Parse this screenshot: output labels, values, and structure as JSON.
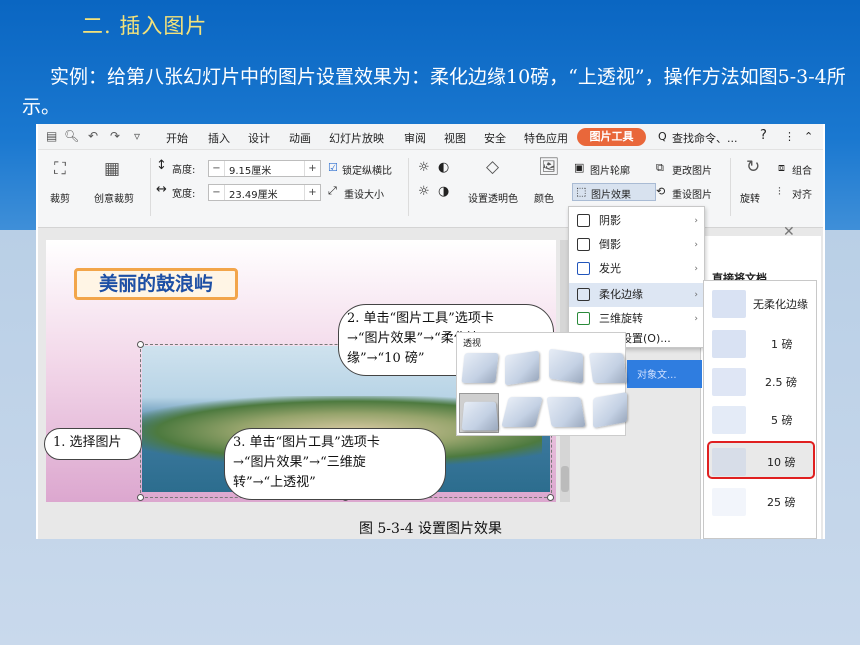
{
  "slide": {
    "heading": "二. 插入图片",
    "body": "实例：给第八张幻灯片中的图片设置效果为：柔化边缘10磅，“上透视”，操作方法如图5-3-4所示。",
    "caption": "图 5-3-4  设置图片效果"
  },
  "menubar": {
    "items": [
      "开始",
      "插入",
      "设计",
      "动画",
      "幻灯片放映",
      "审阅",
      "视图",
      "安全",
      "特色应用"
    ],
    "active_tab": "图片工具",
    "search": "查找命令、...",
    "help": "?"
  },
  "ribbon": {
    "crop": "裁剪",
    "creative_crop": "创意裁剪",
    "height_label": "高度:",
    "height_value": "9.15厘米",
    "width_label": "宽度:",
    "width_value": "23.49厘米",
    "lock_ratio": "锁定纵横比",
    "reset_size": "重设大小",
    "transparent": "设置透明色",
    "color": "颜色",
    "outline": "图片轮廓",
    "effect": "图片效果",
    "change": "更改图片",
    "reset_pic": "重设图片",
    "rotate": "旋转",
    "group": "组合",
    "align": "对齐"
  },
  "canvas": {
    "slide_title": "美丽的鼓浪屿",
    "callout1": "1. 选择图片",
    "callout2_l1": "2. 单击“图片工具”选项卡",
    "callout2_l2": "→“图片效果”→“柔化边",
    "callout2_l3": "缘”→“10 磅”",
    "callout3_l1": "3. 单击“图片工具”选项卡",
    "callout3_l2": "→“图片效果”→“三维旋",
    "callout3_l3": "转”→“上透视”"
  },
  "effects_menu": {
    "items": [
      "阴影",
      "倒影",
      "发光",
      "柔化边缘",
      "三维旋转"
    ],
    "settings": "设置(O)..."
  },
  "pane": {
    "title": "直接将文档",
    "strip": "对象文..."
  },
  "soft_edges": {
    "options": [
      "无柔化边缘",
      "1 磅",
      "2.5 磅",
      "5 磅",
      "10 磅",
      "25 磅"
    ],
    "selected": "10 磅"
  },
  "perspective": {
    "title": "透视"
  },
  "colors": {
    "accent": "#e9673a",
    "heading": "#f4e27a",
    "highlight": "#e02020"
  }
}
